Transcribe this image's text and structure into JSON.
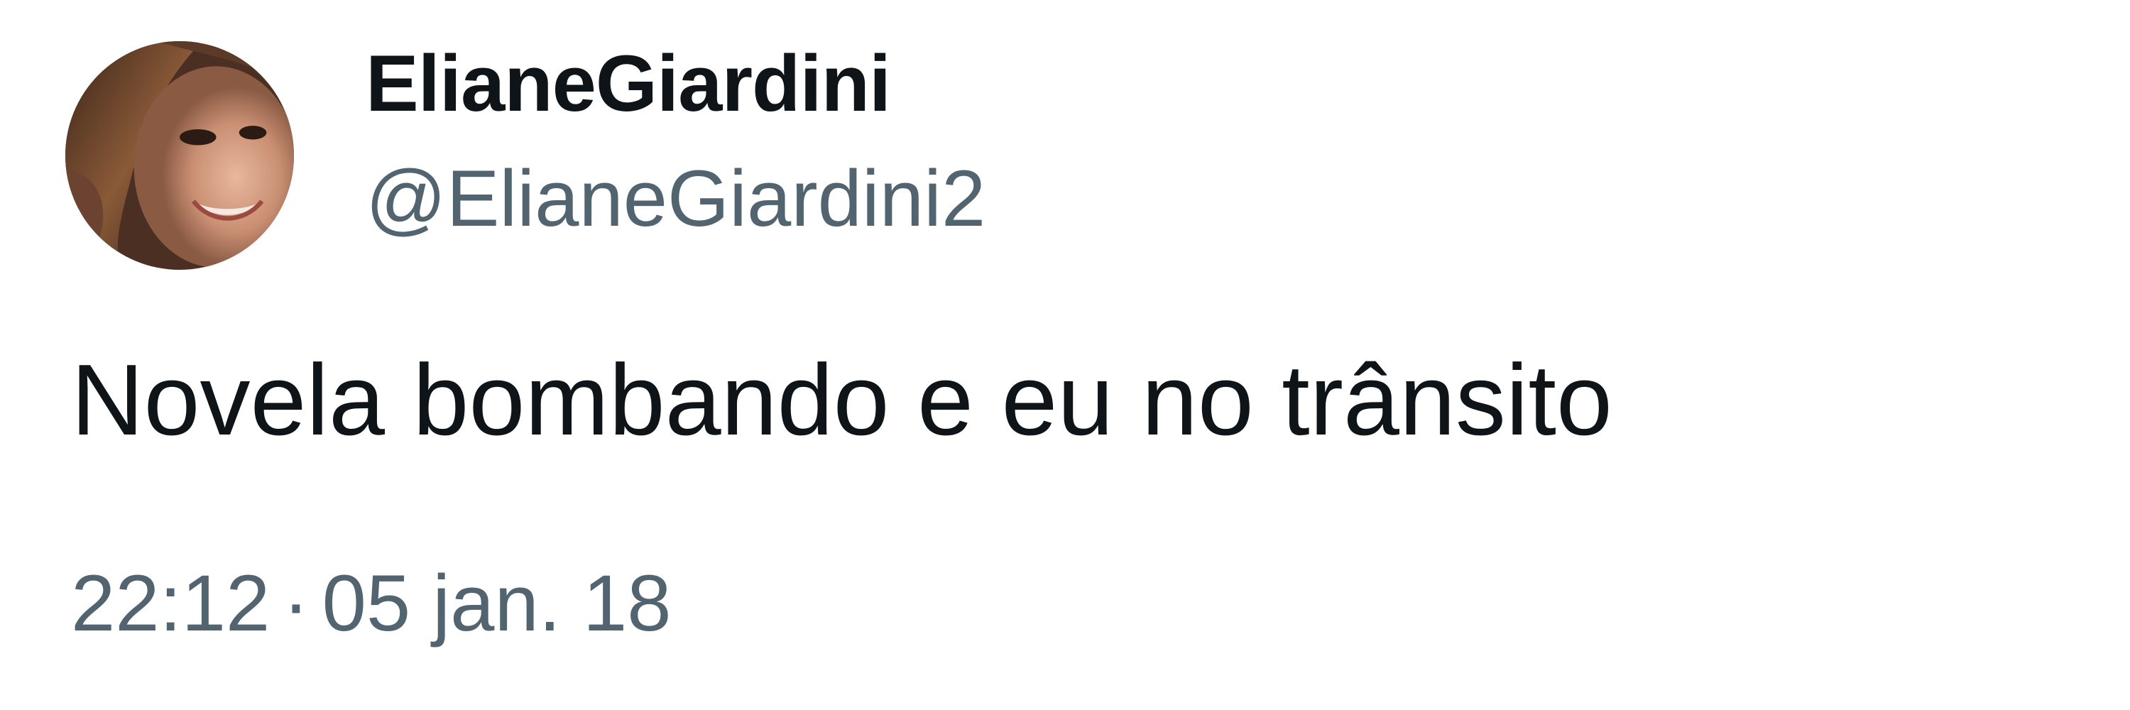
{
  "tweet": {
    "author": {
      "display_name": "ElianeGiardini",
      "handle": "@ElianeGiardini2"
    },
    "text": "Novela bombando e eu no trânsito",
    "time": "22:12",
    "separator": "·",
    "date": "05 jan. 18"
  },
  "icons": {
    "avatar": "profile-photo"
  },
  "colors": {
    "text_primary": "#0f1419",
    "text_secondary": "#536471",
    "background": "#ffffff"
  }
}
